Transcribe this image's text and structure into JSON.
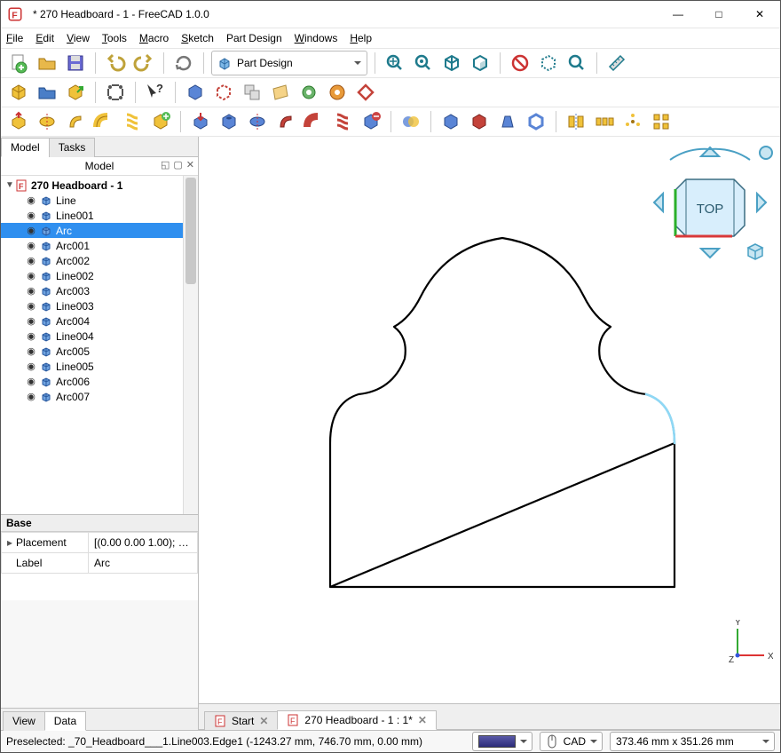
{
  "window": {
    "title": "* 270 Headboard - 1 - FreeCAD 1.0.0"
  },
  "menu": {
    "file": "File",
    "edit": "Edit",
    "view": "View",
    "tools": "Tools",
    "macro": "Macro",
    "sketch": "Sketch",
    "part_design": "Part Design",
    "windows": "Windows",
    "help": "Help"
  },
  "workbench": {
    "label": "Part Design"
  },
  "left_panel": {
    "tab_model": "Model",
    "tab_tasks": "Tasks",
    "tree_header": "Model",
    "root": "270 Headboard - 1",
    "items": [
      {
        "label": "Line"
      },
      {
        "label": "Line001"
      },
      {
        "label": "Arc",
        "selected": true
      },
      {
        "label": "Arc001"
      },
      {
        "label": "Arc002"
      },
      {
        "label": "Line002"
      },
      {
        "label": "Arc003"
      },
      {
        "label": "Line003"
      },
      {
        "label": "Arc004"
      },
      {
        "label": "Line004"
      },
      {
        "label": "Arc005"
      },
      {
        "label": "Line005"
      },
      {
        "label": "Arc006"
      },
      {
        "label": "Arc007"
      }
    ],
    "properties": {
      "header": "Base",
      "rows": [
        {
          "k": "Placement",
          "v": "[(0.00 0.00 1.00); 0...."
        },
        {
          "k": "Label",
          "v": "Arc"
        }
      ]
    },
    "bottom_tabs": {
      "view": "View",
      "data": "Data"
    }
  },
  "doc_tabs": [
    {
      "label": "Start",
      "active": false
    },
    {
      "label": "270 Headboard - 1 : 1*",
      "active": true
    }
  ],
  "nav_cube": {
    "face": "TOP"
  },
  "axes": {
    "x": "X",
    "y": "Y",
    "z": "Z"
  },
  "statusbar": {
    "preselected": "Preselected: _70_Headboard___1.Line003.Edge1 (-1243.27 mm, 746.70 mm, 0.00 mm)",
    "nav_style": "CAD",
    "dims": "373.46 mm x 351.26 mm"
  }
}
